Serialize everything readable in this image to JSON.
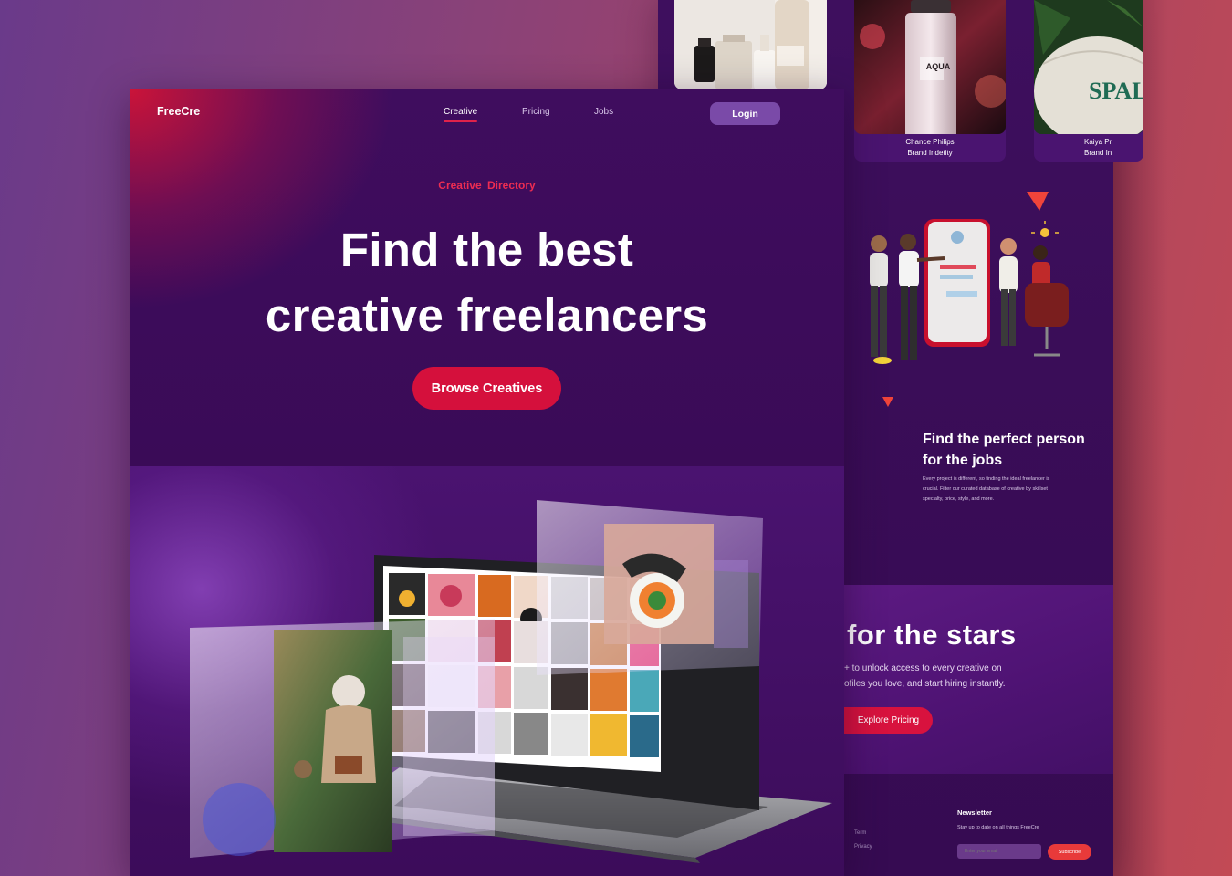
{
  "hero": {
    "logo": "FreeCre",
    "nav": [
      "Creative",
      "Pricing",
      "Jobs"
    ],
    "login": "Login",
    "eyebrow": "Creative  Directory",
    "headline_line1": "Find the best",
    "headline_line2": "creative freelancers",
    "cta": "Browse Creatives"
  },
  "cards": [
    {
      "name": "Chance Philips",
      "role": "Brand Indetity"
    },
    {
      "name": "Kaiya Pr",
      "role": "Brand In"
    }
  ],
  "product_labels": {
    "aqua_brand": "AQUA",
    "ball_text": "SPALD"
  },
  "feature": {
    "title_line1": "Find the perfect person",
    "title_line2": "for the jobs",
    "body_line1": "Every project is different, so finding  the ideal freelancer is",
    "body_line2": "crucial. Filter our curated database of creative by skillset",
    "body_line3": "specialty, price, style, and more."
  },
  "stars": {
    "title": "for the stars",
    "body_line1": "+ to unlock access to every creative on",
    "body_line2": "ofiles you love, and start hiring instantly.",
    "cta": "Explore Pricing"
  },
  "footer": {
    "links": [
      "Term",
      "Privacy"
    ],
    "newsletter_title": "Newsletter",
    "newsletter_body": "Stay up to date on all things FreeCre",
    "email_placeholder": "Enter your email",
    "subscribe": "Subscribe"
  },
  "colors": {
    "accent": "#d5103c",
    "panel": "#3a0b57",
    "login": "#7a4aa8"
  }
}
